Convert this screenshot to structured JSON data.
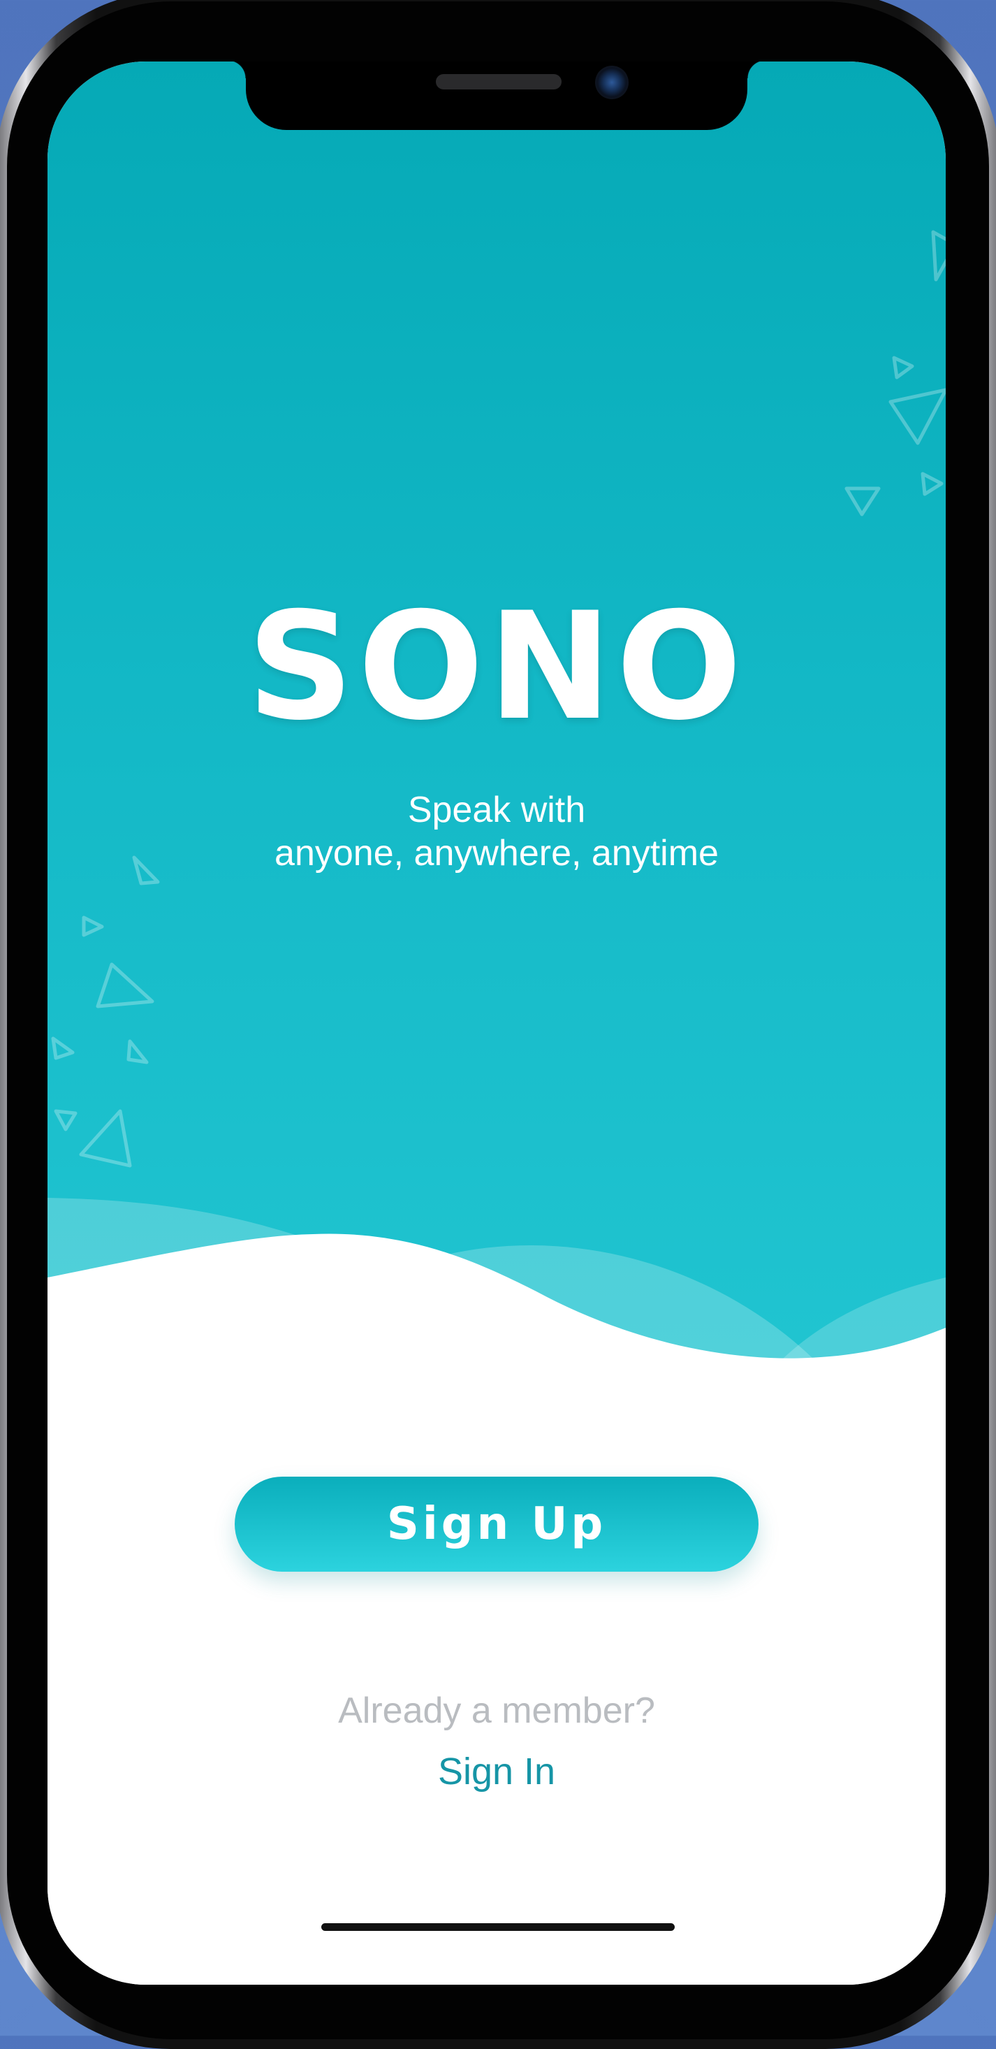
{
  "app": {
    "logo_text": "SONO",
    "tagline_line1": "Speak with",
    "tagline_line2": "anyone, anywhere, anytime"
  },
  "auth": {
    "signup_label": "Sign Up",
    "member_prompt": "Already a member?",
    "signin_label": "Sign In"
  },
  "colors": {
    "brand_teal": "#13b8c6",
    "link_teal": "#1695a6",
    "muted_text": "#b9bcc0",
    "background_blue": "#5a80c8"
  }
}
